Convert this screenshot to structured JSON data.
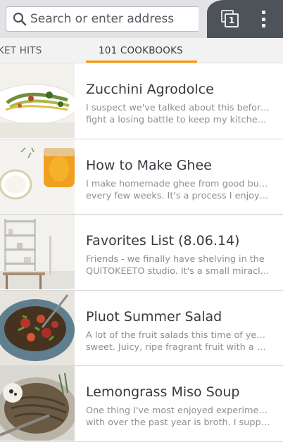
{
  "urlbar": {
    "placeholder": "Search or enter address"
  },
  "toolbar": {
    "tab_count": "1"
  },
  "tab_strip": {
    "tabs": [
      {
        "label": "KET HITS"
      },
      {
        "label": "101 COOKBOOKS"
      }
    ],
    "accent_color": "#ff9500"
  },
  "articles": [
    {
      "title": "Zucchini Agrodolce",
      "line1": "I suspect we've talked about this before. I",
      "line2": "fight a losing battle to keep my kitchen…"
    },
    {
      "title": "How to Make Ghee",
      "line1": "I make homemade ghee from good butter",
      "line2": "every few weeks. It's a process I enjoy, an…"
    },
    {
      "title": "Favorites List (8.06.14)",
      "line1": "Friends - we finally have shelving in the",
      "line2": "QUITOKEETO studio. It's a small miracle.…"
    },
    {
      "title": "Pluot Summer Salad",
      "line1": "A lot of the fruit salads this time of year are",
      "line2": "sweet. Juicy, ripe fragrant fruit with a swe…"
    },
    {
      "title": "Lemongrass Miso Soup",
      "line1": "One thing I've most enjoyed experimenting",
      "line2": "with over the past year is broth. I suppose…"
    }
  ]
}
